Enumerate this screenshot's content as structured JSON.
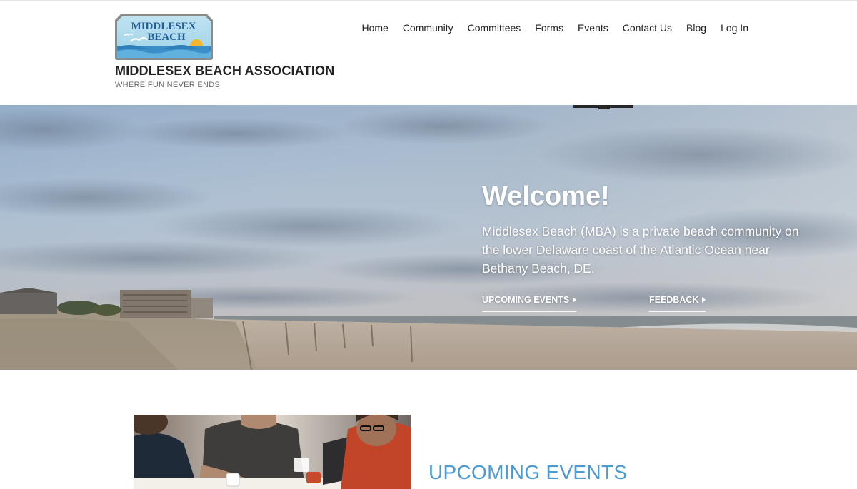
{
  "brand": {
    "logo_line1": "MIDDLESEX",
    "logo_line2": "BEACH",
    "title": "MIDDLESEX BEACH ASSOCIATION",
    "tagline": "WHERE FUN NEVER ENDS"
  },
  "nav": {
    "items": [
      "Home",
      "Community",
      "Committees",
      "Forms",
      "Events",
      "Contact Us",
      "Blog",
      "Log In"
    ]
  },
  "hero": {
    "title": "Welcome!",
    "text": "Middlesex Beach (MBA) is a private beach community on the lower Delaware coast of the Atlantic Ocean near Bethany Beach, DE.",
    "events_link": "UPCOMING EVENTS",
    "feedback_link": "FEEDBACK"
  },
  "events_section": {
    "heading": "UPCOMING EVENTS"
  },
  "colors": {
    "accent": "#4a9ad4",
    "logo_sky": "#7ec3e0",
    "logo_frame": "#8a8a8a",
    "logo_sun": "#f5b52e"
  }
}
